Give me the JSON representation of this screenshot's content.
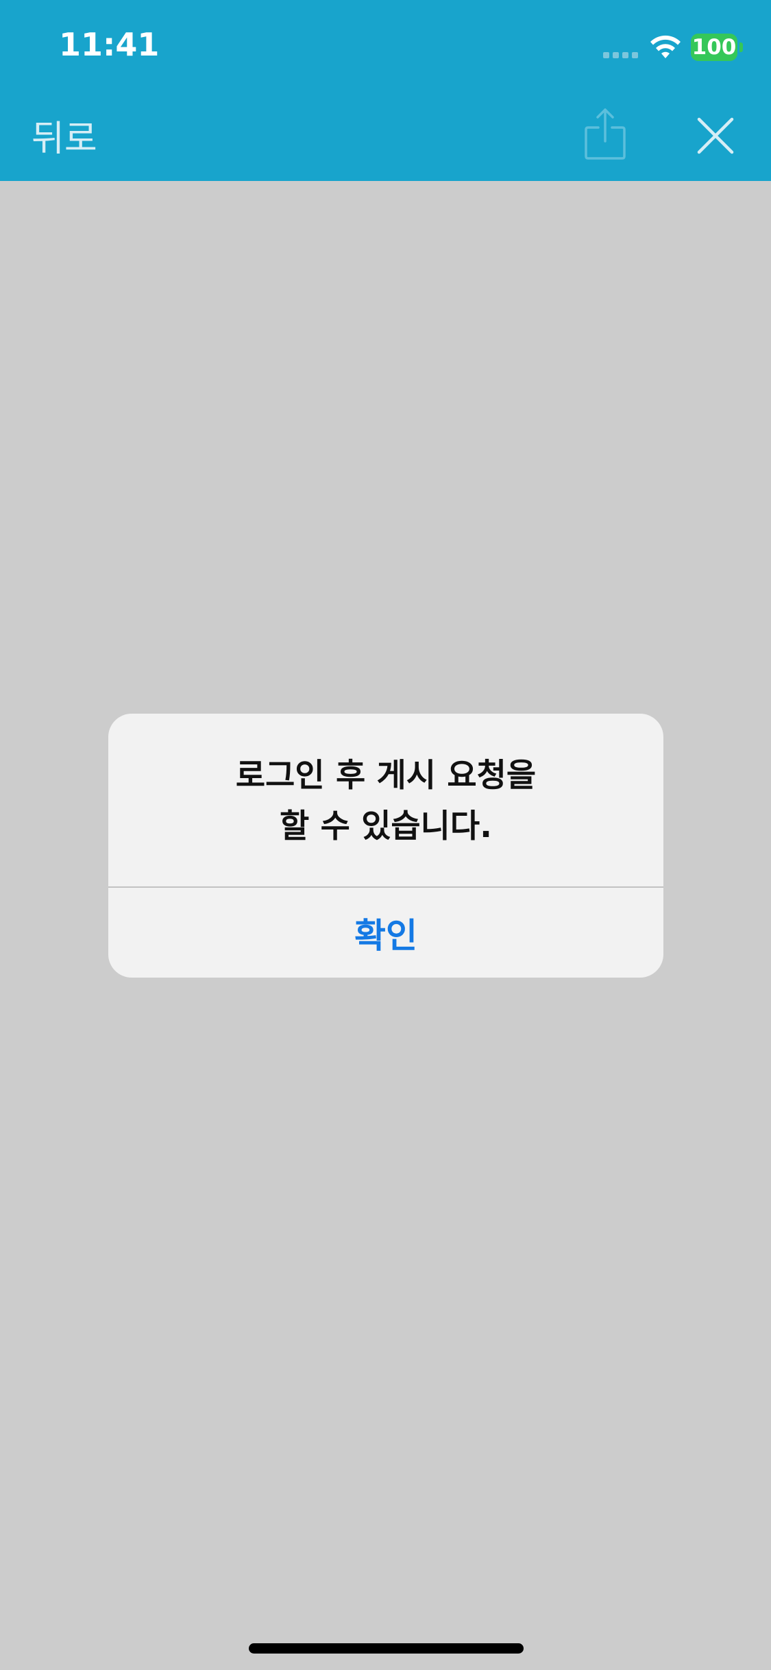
{
  "status_bar": {
    "time": "11:41",
    "battery": "100",
    "icons": [
      "signal-dots-icon",
      "wifi-icon",
      "battery-icon"
    ]
  },
  "nav_bar": {
    "back_label": "뒤로",
    "icons": [
      "share-icon",
      "close-icon"
    ]
  },
  "alert": {
    "message_lines": [
      "로그인 후 게시 요청을",
      "할 수 있습니다."
    ],
    "confirm_label": "확인"
  },
  "colors": {
    "header": "#18a4cc",
    "background": "#cccccc",
    "alert_background": "#f2f2f2",
    "button_text": "#1479e4",
    "battery": "#35c759"
  }
}
